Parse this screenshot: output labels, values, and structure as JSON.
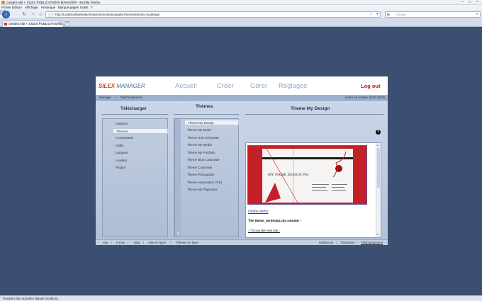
{
  "browser": {
    "title": "create3.edit < SILEX PUBLICATIONS MANAGER - Mozilla Firefox",
    "menu": [
      "Fichier",
      "Édition",
      "Affichage",
      "Historique",
      "Marque-pages",
      "Outils",
      "?"
    ],
    "url": "http://localhost/website/4/start/menu/download/d.themes/theme.my.design",
    "search_placeholder": "Google",
    "search_engine_glyph": "G",
    "tab_title": "create3.edit < SILEX PUBLICATIONS ...",
    "status": "Transfert des données depuis localhost..."
  },
  "app": {
    "logo_silex": "SILEX",
    "logo_manager": "MANAGER",
    "nav": [
      "Accueil",
      "Créer",
      "Gérer",
      "Réglages"
    ],
    "logout": "Log out",
    "breadcrumb": [
      "Manager",
      "Téléchargement"
    ],
    "breadcrumb_sep": "»",
    "date": "mardi 19 octobre 2010 10h25",
    "col_download": "Télécharger",
    "col_themes": "Thèmes",
    "col_detail": "Theme My Design",
    "help_glyph": "?",
    "categories": [
      "Gabarits",
      "Thèmes",
      "Composants",
      "Outils",
      "Langues",
      "Loaders",
      "Plugins"
    ],
    "selected_category": "Thèmes",
    "themes": [
      "Theme My Design",
      "Theme My Music",
      "Theme Red Corporate",
      "Theme My Media",
      "Theme My Portfolio",
      "Theme Blue Corporate",
      "Theme Corporate",
      "Theme Photograph",
      "Theme Association 2010",
      "Theme My Page plus"
    ],
    "selected_theme": "Theme My Design",
    "preview_text": "MY NAME DESIGN #02",
    "online_demo": "Online demo",
    "contains": "The theme_mydesign.zip contains :",
    "use_link": "> To use the web site :",
    "footer_left": [
      "Site",
      "Forum",
      "Blog",
      "Aide en ligne",
      "Thèmes en ligne"
    ],
    "footer_right": [
      "Mailing list",
      "Traduction",
      "Téléchargement"
    ],
    "colors": {
      "accent_red": "#d80d12",
      "logo_orange": "#d8430e",
      "nav_blue": "#8fa8cc",
      "panel_blue": "#b4c3dc"
    }
  }
}
